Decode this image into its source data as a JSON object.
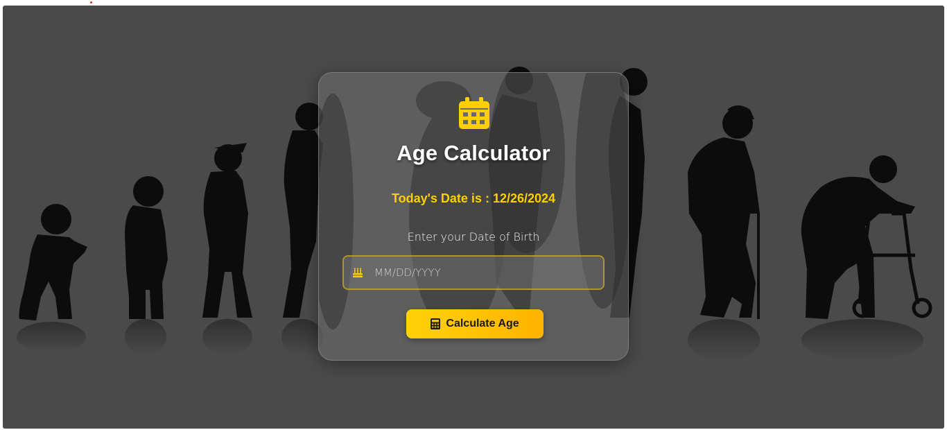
{
  "app": {
    "title": "Age Calculator"
  },
  "today": {
    "text": "Today's Date is : 12/26/2024"
  },
  "form": {
    "dob_label": "Enter your Date of Birth",
    "dob_placeholder": "MM/DD/YYYY",
    "dob_value": "",
    "submit_label": "Calculate Age"
  },
  "icons": {
    "header": "calendar-icon",
    "input": "birthday-cake-icon",
    "button": "calculator-icon"
  },
  "colors": {
    "background": "#4a4a4a",
    "accent": "#ffd000",
    "button_gradient_start": "#ffd20a",
    "button_gradient_end": "#ffb300",
    "title": "#ffffff"
  }
}
